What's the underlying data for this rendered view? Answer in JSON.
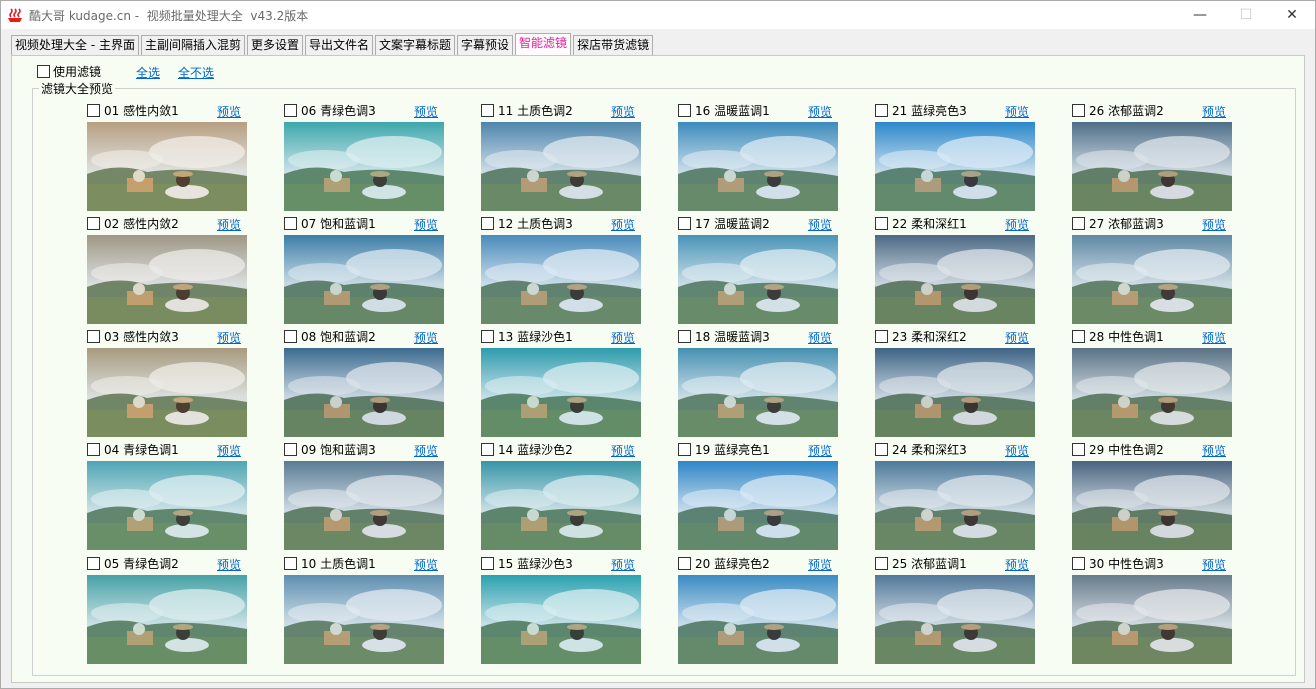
{
  "window": {
    "title": "酷大哥 kudage.cn -  视频批量处理大全  v43.2版本"
  },
  "tabs": [
    {
      "label": "视频处理大全 - 主界面",
      "active": false
    },
    {
      "label": "主副间隔插入混剪",
      "active": false
    },
    {
      "label": "更多设置",
      "active": false
    },
    {
      "label": "导出文件名",
      "active": false
    },
    {
      "label": "文案字幕标题",
      "active": false
    },
    {
      "label": "字幕预设",
      "active": false
    },
    {
      "label": "智能滤镜",
      "active": true
    },
    {
      "label": "探店带货滤镜",
      "active": false
    }
  ],
  "controls": {
    "use_filter_label": "使用滤镜",
    "use_filter_checked": false,
    "select_all": "全选",
    "select_none": "全不选"
  },
  "preview": {
    "group_title": "滤镜大全预览",
    "preview_link": "预览",
    "items": [
      {
        "label": "01 感性内敛1",
        "tint": "#b89f82"
      },
      {
        "label": "02 感性内敛2",
        "tint": "#a09886"
      },
      {
        "label": "03 感性内敛3",
        "tint": "#a89a80"
      },
      {
        "label": "04 青绿色调1",
        "tint": "#4fa6b4"
      },
      {
        "label": "05 青绿色调2",
        "tint": "#46a2a6"
      },
      {
        "label": "06 青绿色调3",
        "tint": "#3ea8ac"
      },
      {
        "label": "07 饱和蓝调1",
        "tint": "#3c7ea8"
      },
      {
        "label": "08 饱和蓝调2",
        "tint": "#3c6c90"
      },
      {
        "label": "09 饱和蓝调3",
        "tint": "#5a7c94"
      },
      {
        "label": "10 土质色调1",
        "tint": "#5f8fb0"
      },
      {
        "label": "11 土质色调2",
        "tint": "#4e86ac"
      },
      {
        "label": "12 土质色调3",
        "tint": "#4a8cbc"
      },
      {
        "label": "13 蓝绿沙色1",
        "tint": "#2e9cae"
      },
      {
        "label": "14 蓝绿沙色2",
        "tint": "#3696a8"
      },
      {
        "label": "15 蓝绿沙色3",
        "tint": "#2aa2b0"
      },
      {
        "label": "16 温暖蓝调1",
        "tint": "#3c8cbc"
      },
      {
        "label": "17 温暖蓝调2",
        "tint": "#4a94b8"
      },
      {
        "label": "18 温暖蓝调3",
        "tint": "#4690b2"
      },
      {
        "label": "19 蓝绿亮色1",
        "tint": "#2f86c8"
      },
      {
        "label": "20 蓝绿亮色2",
        "tint": "#3a8cc4"
      },
      {
        "label": "21 蓝绿亮色3",
        "tint": "#2c88cc"
      },
      {
        "label": "22 柔和深红1",
        "tint": "#4c6a86"
      },
      {
        "label": "23 柔和深红2",
        "tint": "#3e6486"
      },
      {
        "label": "24 柔和深红3",
        "tint": "#4e7a9a"
      },
      {
        "label": "25 浓郁蓝调1",
        "tint": "#52789a"
      },
      {
        "label": "26 浓郁蓝调2",
        "tint": "#4f6f88"
      },
      {
        "label": "27 浓郁蓝调3",
        "tint": "#5e88a4"
      },
      {
        "label": "28 中性色调1",
        "tint": "#5a7286"
      },
      {
        "label": "29 中性色调2",
        "tint": "#4a6480"
      },
      {
        "label": "30 中性色调3",
        "tint": "#687c8c"
      }
    ]
  }
}
